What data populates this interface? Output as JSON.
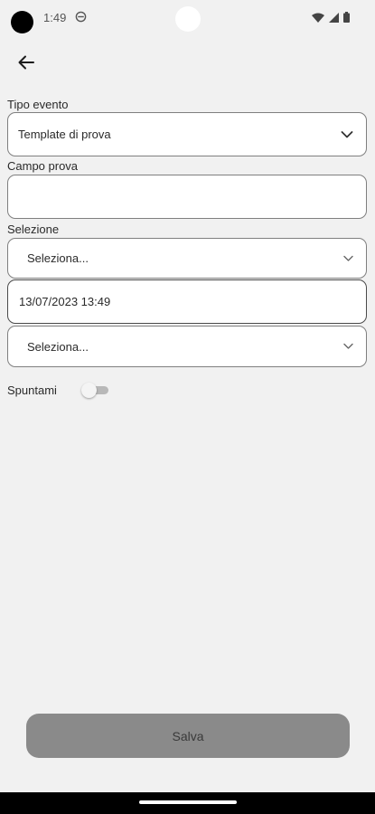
{
  "status_bar": {
    "time": "1:49",
    "icons": [
      "dnd-icon",
      "wifi-icon",
      "cellular-signal-icon",
      "battery-icon"
    ]
  },
  "form": {
    "event_type": {
      "label": "Tipo evento",
      "value": "Template di prova"
    },
    "test_field": {
      "label": "Campo prova",
      "value": ""
    },
    "selection": {
      "label": "Selezione",
      "select_1_value": "Seleziona...",
      "datetime_value": "13/07/2023 13:49",
      "select_2_value": "Seleziona..."
    },
    "toggle": {
      "label": "Spuntami",
      "checked": false
    }
  },
  "actions": {
    "save_label": "Salva"
  },
  "colors": {
    "background": "#f1f1f1",
    "field_bg": "#ffffff",
    "save_button_bg": "#8a8a8a"
  }
}
